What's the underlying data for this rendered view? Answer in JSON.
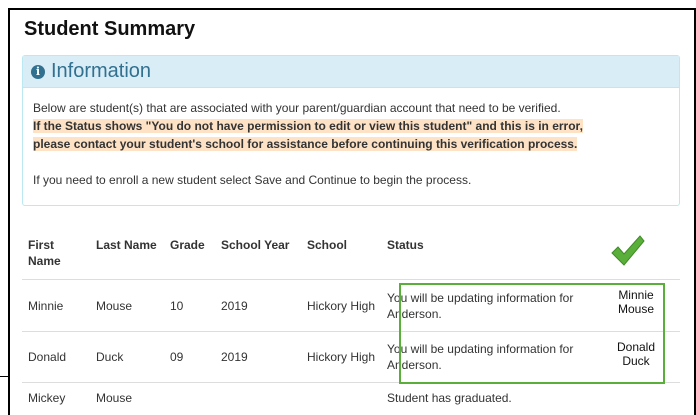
{
  "panel": {
    "title": "Student Summary"
  },
  "info": {
    "heading": "Information",
    "line1": "Below are student(s) that are associated with your parent/guardian account that need to be verified.",
    "line2": "If the Status shows \"You do not have permission to edit or view this student\" and this is in error,",
    "line3": "please contact your student's school for assistance before continuing this verification process.",
    "line4": "If you need to enroll a new student select Save and Continue to begin the process."
  },
  "table": {
    "headers": {
      "first": "First Name",
      "last": "Last Name",
      "grade": "Grade",
      "year": "School Year",
      "school": "School",
      "status": "Status"
    },
    "rows": [
      {
        "first": "Minnie",
        "last": "Mouse",
        "grade": "10",
        "year": "2019",
        "school": "Hickory High",
        "status": "You will be updating information for Anderson."
      },
      {
        "first": "Donald",
        "last": "Duck",
        "grade": "09",
        "year": "2019",
        "school": "Hickory High",
        "status": "You will be updating information for Anderson."
      },
      {
        "first": "Mickey",
        "last": "Mouse",
        "grade": "",
        "year": "",
        "school": "",
        "status": "Student has graduated."
      }
    ]
  },
  "annotations": {
    "name1": "Minnie Mouse",
    "name2": "Donald Duck",
    "check_color": "#5aae3a",
    "check_icon": "checkmark-icon"
  }
}
